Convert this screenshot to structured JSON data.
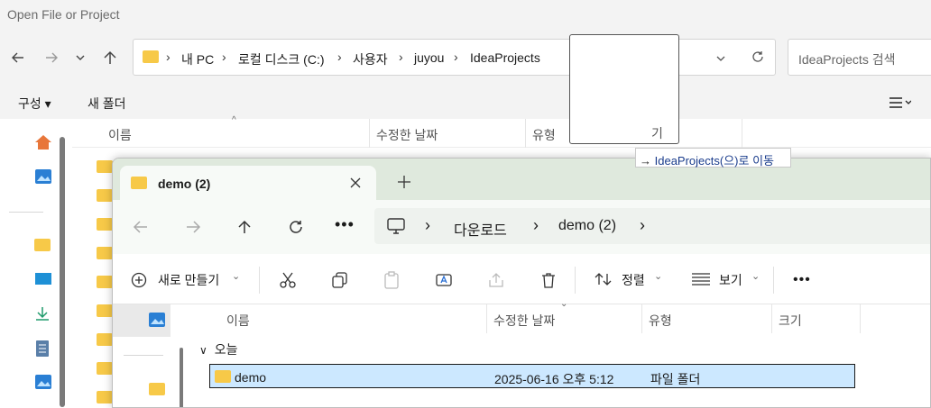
{
  "dialog": {
    "title": "Open File or Project",
    "breadcrumb": [
      "내 PC",
      "로컬 디스크 (C:)",
      "사용자",
      "juyou",
      "IdeaProjects"
    ],
    "search_placeholder": "IdeaProjects 검색",
    "cmd_organize": "구성",
    "cmd_new_folder": "새 폴더",
    "columns": [
      "이름",
      "수정한 날짜",
      "유형",
      "크기"
    ]
  },
  "drag": {
    "tooltip_text": "IdeaProjects(으)로 이동"
  },
  "explorer": {
    "tab_title": "demo (2)",
    "breadcrumb": [
      "다운로드",
      "demo (2)"
    ],
    "cmd_new": "새로 만들기",
    "cmd_sort": "정렬",
    "cmd_view": "보기",
    "columns": [
      "이름",
      "수정한 날짜",
      "유형",
      "크기"
    ],
    "group_label": "오늘",
    "rows": [
      {
        "name": "demo",
        "modified": "2025-06-16 오후 5:12",
        "type": "파일 폴더",
        "size": ""
      }
    ]
  },
  "colors": {
    "accent_selection": "#cce8ff",
    "folder_yellow": "#f7c948",
    "tab_strip": "#dfe9dd"
  }
}
